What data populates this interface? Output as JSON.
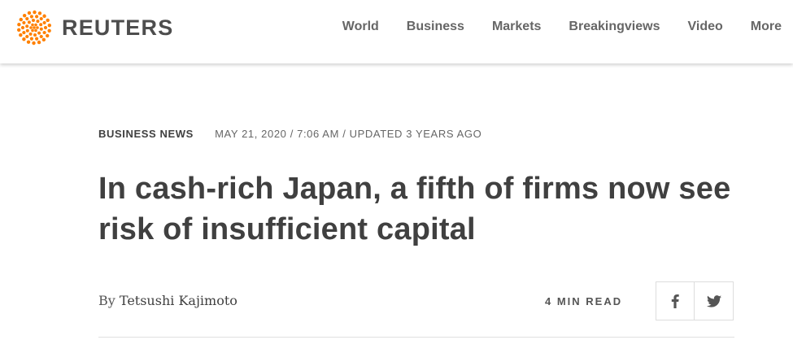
{
  "header": {
    "brand": "REUTERS",
    "brand_color": "#ff8000",
    "nav": [
      "World",
      "Business",
      "Markets",
      "Breakingviews",
      "Video",
      "More"
    ]
  },
  "article": {
    "section": "BUSINESS NEWS",
    "dateline": "MAY 21, 2020 / 7:06 AM / UPDATED 3 YEARS AGO",
    "headline": "In cash-rich Japan, a fifth of firms now see risk of insufficient capital",
    "byline_prefix": "By",
    "author": "Tetsushi Kajimoto",
    "read_time": "4 MIN READ"
  },
  "share": {
    "buttons": [
      {
        "icon": "facebook-icon"
      },
      {
        "icon": "twitter-icon"
      }
    ]
  }
}
